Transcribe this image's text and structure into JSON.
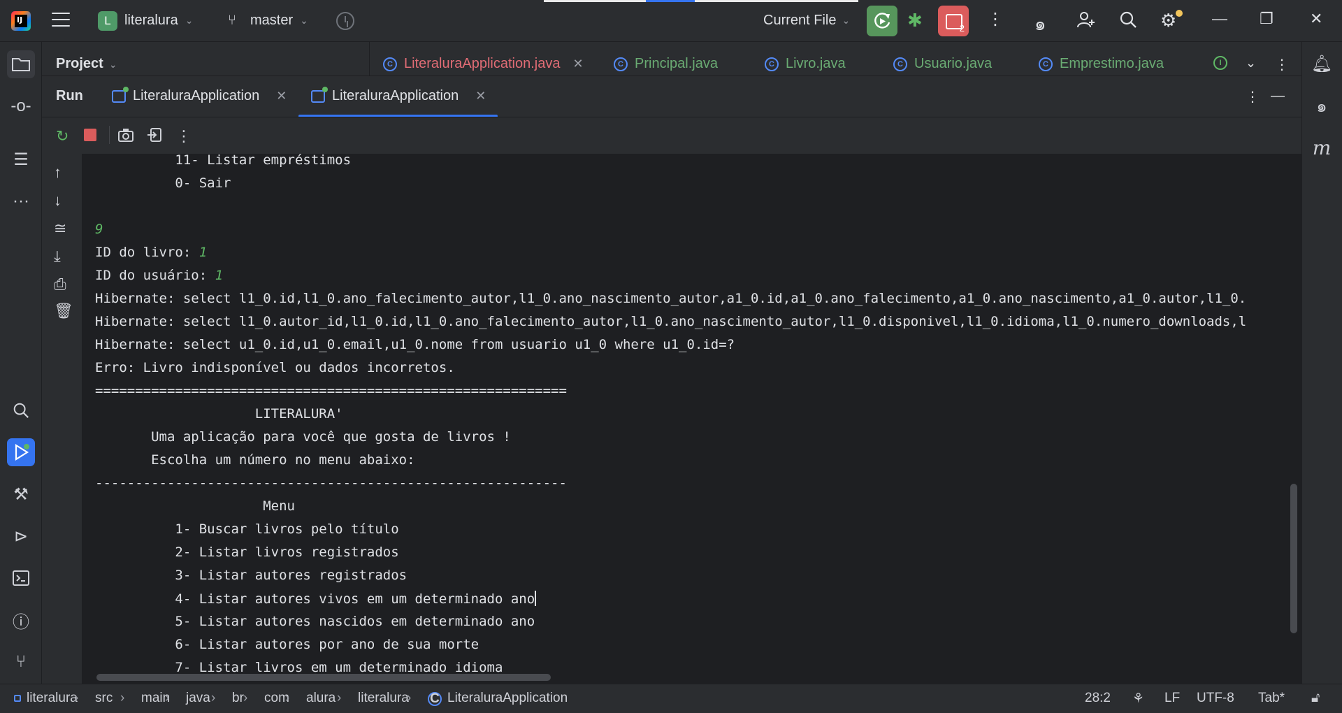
{
  "titlebar": {
    "project_initial": "L",
    "project_name": "literalura",
    "branch": "master",
    "run_config": "Current File",
    "run_badge": "2"
  },
  "project_panel": {
    "title": "Project"
  },
  "editor_tabs": [
    {
      "label": "LiteraluraApplication.java",
      "color": "#e06c75",
      "closable": true
    },
    {
      "label": "Principal.java",
      "color": "#6aab73"
    },
    {
      "label": "Livro.java",
      "color": "#6aab73"
    },
    {
      "label": "Usuario.java",
      "color": "#6aab73"
    },
    {
      "label": "Emprestimo.java",
      "color": "#6aab73"
    }
  ],
  "run_panel": {
    "title": "Run",
    "tabs": [
      {
        "label": "LiteraluraApplication",
        "active": false
      },
      {
        "label": "LiteraluraApplication",
        "active": true
      }
    ]
  },
  "console": {
    "lines": [
      {
        "text": "          11- Listar empréstimos"
      },
      {
        "text": "          0- Sair"
      },
      {
        "text": ""
      },
      {
        "text": "",
        "input": "9"
      },
      {
        "text": "ID do livro: ",
        "input": "1"
      },
      {
        "text": "ID do usuário: ",
        "input": "1"
      },
      {
        "text": "Hibernate: select l1_0.id,l1_0.ano_falecimento_autor,l1_0.ano_nascimento_autor,a1_0.id,a1_0.ano_falecimento,a1_0.ano_nascimento,a1_0.autor,l1_0."
      },
      {
        "text": "Hibernate: select l1_0.autor_id,l1_0.id,l1_0.ano_falecimento_autor,l1_0.ano_nascimento_autor,l1_0.disponivel,l1_0.idioma,l1_0.numero_downloads,l"
      },
      {
        "text": "Hibernate: select u1_0.id,u1_0.email,u1_0.nome from usuario u1_0 where u1_0.id=?"
      },
      {
        "text": "Erro: Livro indisponível ou dados incorretos."
      },
      {
        "text": "==========================================================="
      },
      {
        "text": "                    LITERALURA'"
      },
      {
        "text": "       Uma aplicação para você que gosta de livros !"
      },
      {
        "text": "       Escolha um número no menu abaixo:"
      },
      {
        "text": "-----------------------------------------------------------"
      },
      {
        "text": "                     Menu"
      },
      {
        "text": "          1- Buscar livros pelo título"
      },
      {
        "text": "          2- Listar livros registrados"
      },
      {
        "text": "          3- Listar autores registrados"
      },
      {
        "text": "          4- Listar autores vivos em um determinado ano",
        "caret": true
      },
      {
        "text": "          5- Listar autores nascidos em determinado ano"
      },
      {
        "text": "          6- Listar autores por ano de sua morte"
      },
      {
        "text": "          7- Listar livros em um determinado idioma"
      }
    ]
  },
  "statusbar": {
    "breadcrumb": [
      "literalura",
      "src",
      "main",
      "java",
      "br",
      "com",
      "alura",
      "literalura",
      "LiteraluraApplication"
    ],
    "position": "28:2",
    "line_ending": "LF",
    "encoding": "UTF-8",
    "indent": "Tab*"
  }
}
